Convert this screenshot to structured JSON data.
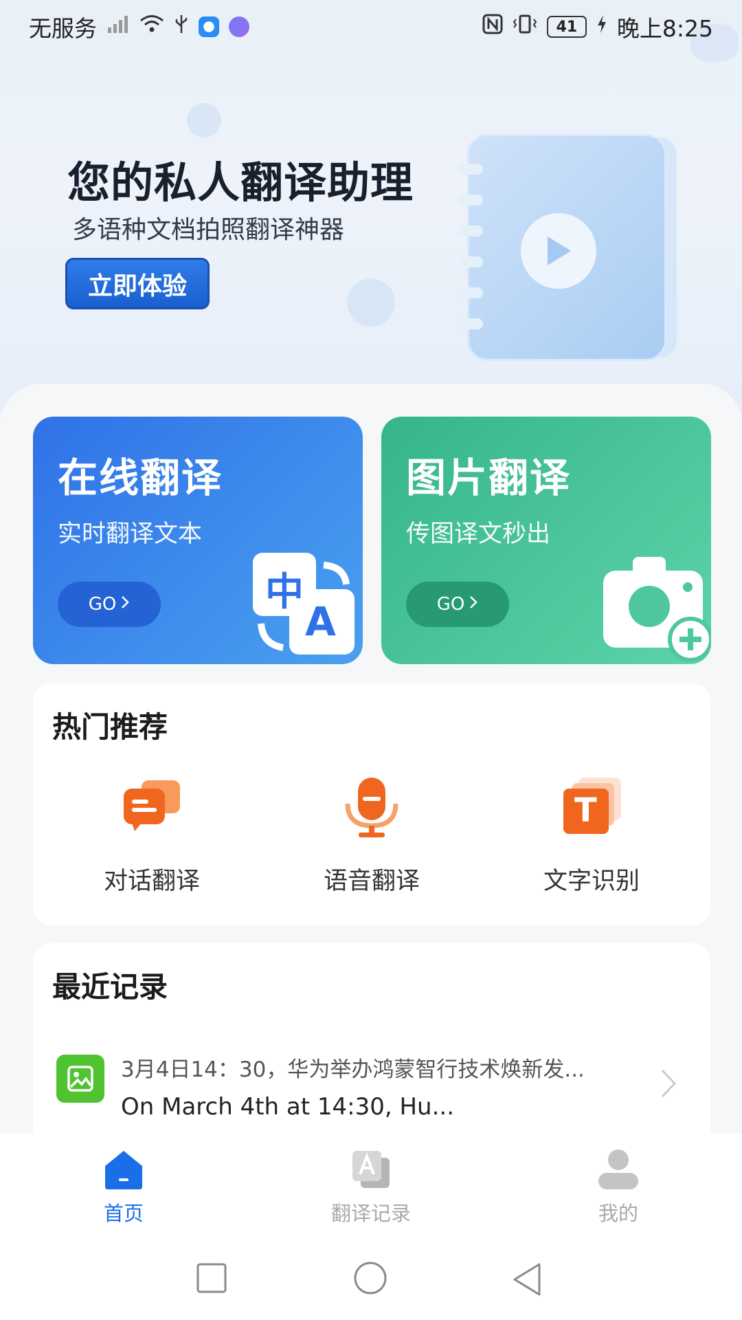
{
  "status_bar": {
    "carrier": "无服务",
    "battery": "41",
    "time": "晚上8:25"
  },
  "hero": {
    "title": "您的私人翻译助理",
    "subtitle": "多语种文档拍照翻译神器",
    "cta_label": "立即体验"
  },
  "feature_cards": [
    {
      "title": "在线翻译",
      "subtitle": "实时翻译文本",
      "go_label": "GO",
      "icon": "zh-en-translate-icon",
      "color": "#2f72e8"
    },
    {
      "title": "图片翻译",
      "subtitle": "传图译文秒出",
      "go_label": "GO",
      "icon": "camera-plus-icon",
      "color": "#36b58a"
    }
  ],
  "hot": {
    "title": "热门推荐",
    "items": [
      {
        "label": "对话翻译",
        "icon": "chat-bubbles-icon"
      },
      {
        "label": "语音翻译",
        "icon": "microphone-icon"
      },
      {
        "label": "文字识别",
        "icon": "text-recognition-icon"
      }
    ]
  },
  "recent": {
    "title": "最近记录",
    "items": [
      {
        "source": "3月4日14：30，华为举办鸿蒙智行技术焕新发...",
        "translation": "On March 4th at 14:30, Hu...",
        "icon": "image-icon"
      }
    ]
  },
  "tab_glyphs": {
    "zh": "中",
    "en": "A",
    "text": "T"
  },
  "bottom_nav": [
    {
      "label": "首页",
      "icon": "home-icon",
      "active": true
    },
    {
      "label": "翻译记录",
      "icon": "translate-record-icon",
      "active": false
    },
    {
      "label": "我的",
      "icon": "profile-icon",
      "active": false
    }
  ],
  "colors": {
    "accent": "#1a6ee8",
    "orange": "#f0661f"
  }
}
